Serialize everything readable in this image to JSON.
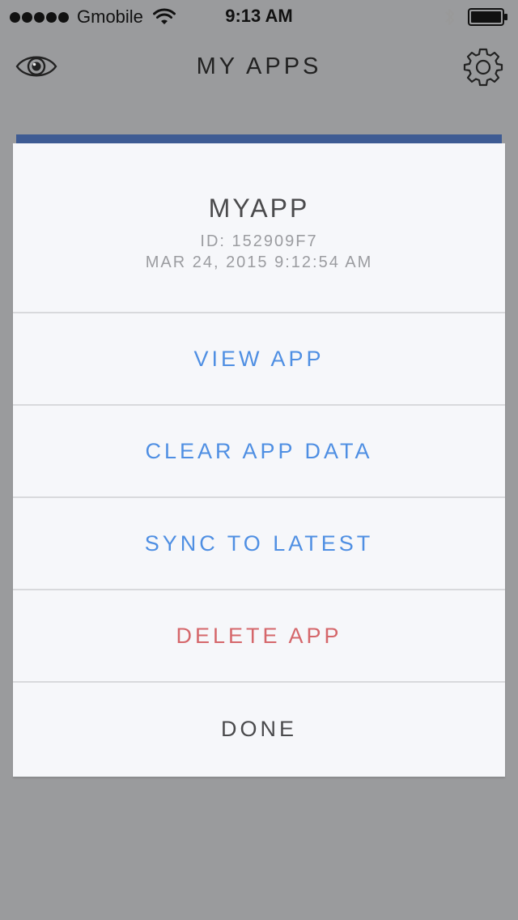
{
  "status_bar": {
    "carrier": "Gmobile",
    "time": "9:13 AM"
  },
  "header": {
    "title": "MY APPS",
    "left_icon": "eye-icon",
    "right_icon": "gear-icon"
  },
  "colors": {
    "accent": "#4f8fe3",
    "destructive": "#d5676b",
    "overlay": "#9a9b9d",
    "card_strip": "#3e5b93"
  },
  "action_sheet": {
    "app_name": "MYAPP",
    "app_id": "ID: 152909F7",
    "app_date": "MAR 24, 2015 9:12:54 AM",
    "actions": {
      "view": "VIEW APP",
      "clear": "CLEAR APP DATA",
      "sync": "SYNC TO LATEST",
      "delete": "DELETE APP",
      "done": "DONE"
    }
  }
}
